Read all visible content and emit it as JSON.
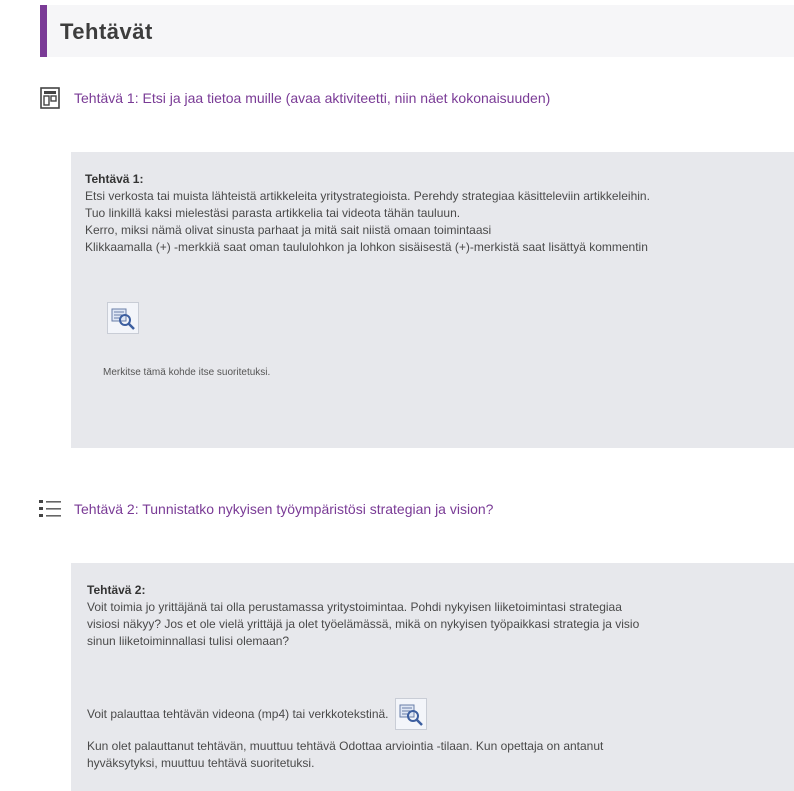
{
  "section": {
    "title": "Tehtävät"
  },
  "activity1": {
    "icon": "board-icon",
    "label": "Tehtävä 1: Etsi ja jaa tietoa muille (avaa aktiviteetti, niin näet kokonaisuuden)"
  },
  "desc1": {
    "title": "Tehtävä 1:",
    "lines": [
      "Etsi verkosta tai muista lähteistä artikkeleita yritystrategioista. Perehdy strategiaa käsitteleviin artikkeleihin.",
      "Tuo linkillä kaksi mielestäsi parasta artikkelia tai videota tähän tauluun.",
      "Kerro, miksi nämä olivat sinusta parhaat ja mitä sait niistä omaan toimintaasi",
      "Klikkaamalla (+) -merkkiä saat oman taululohkon ja lohkon sisäisestä (+)-merkistä saat lisättyä kommentin"
    ],
    "completion_note": "Merkitse tämä kohde itse suoritetuksi."
  },
  "activity2": {
    "icon": "list-icon",
    "label": "Tehtävä 2: Tunnistatko nykyisen työympäristösi strategian ja vision?"
  },
  "desc2": {
    "title": "Tehtävä 2:",
    "lines": [
      "Voit toimia jo yrittäjänä tai olla perustamassa yritystoimintaa. Pohdi nykyisen liiketoimintasi strategiaa",
      "visiosi näkyy? Jos et ole vielä yrittäjä ja olet työelämässä, mikä on nykyisen työpaikkasi strategia ja visio",
      "sinun liiketoiminnallasi tulisi olemaan?"
    ],
    "return_text": "Voit palauttaa tehtävän videona (mp4) tai verkkotekstinä.",
    "after_lines": [
      "Kun olet palauttanut tehtävän, muuttuu tehtävä Odottaa arviointia -tilaan. Kun opettaja on antanut",
      "hyväksytyksi, muuttuu tehtävä suoritetuksi."
    ]
  }
}
